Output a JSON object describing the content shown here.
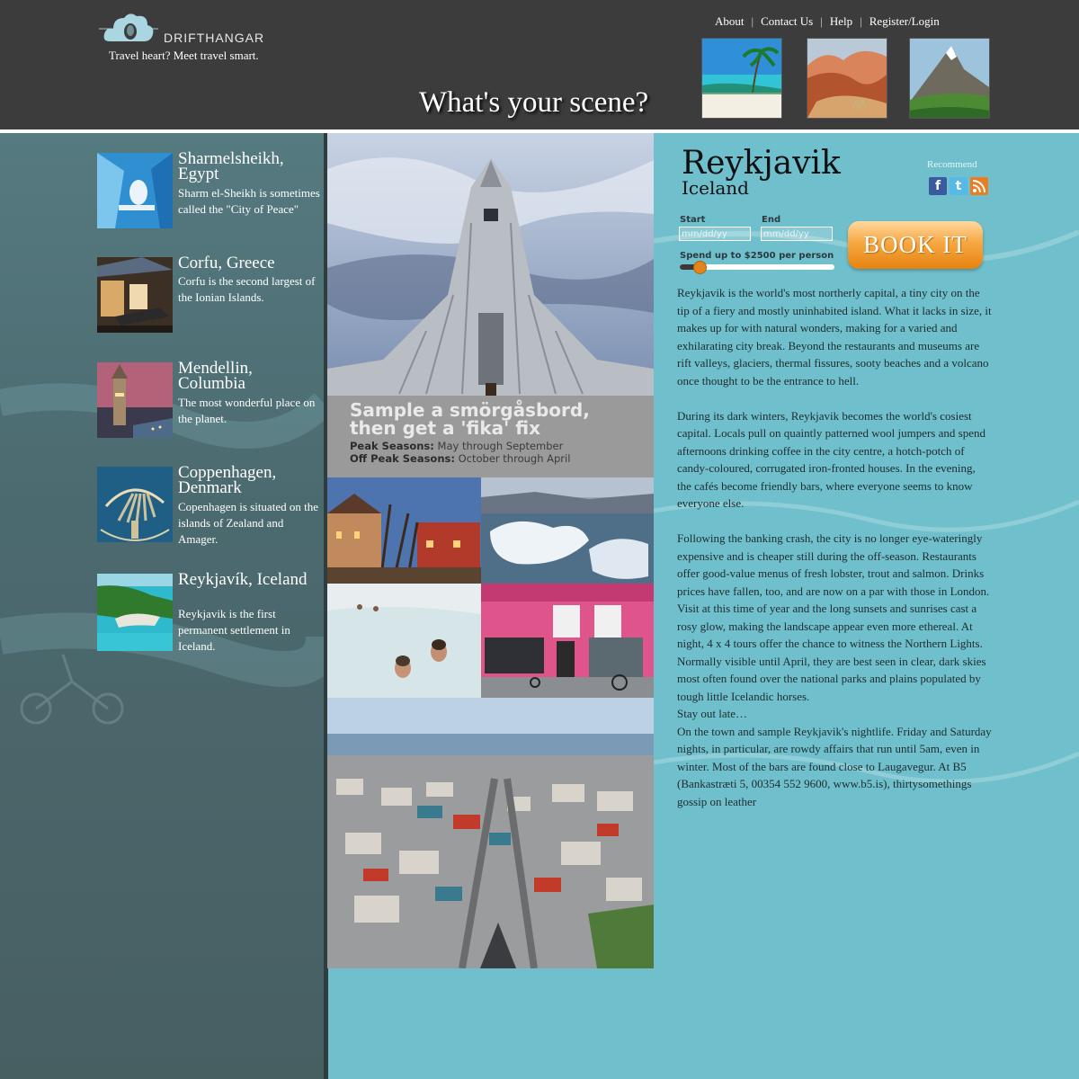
{
  "brand": {
    "name": "DRIFTHANGAR",
    "tagline": "Travel heart?  Meet travel smart."
  },
  "nav": {
    "items": [
      "About",
      "Contact Us",
      "Help",
      "Register/Login"
    ],
    "separator": "|"
  },
  "scene": {
    "title": "What's your scene?",
    "thumbnails": [
      "tropical-beach",
      "red-rock-desert",
      "green-mountain"
    ]
  },
  "sidebar": {
    "destinations": [
      {
        "title": "Sharmelsheikh, Egypt",
        "description": "Sharm el-Sheikh is sometimes called the \"City of Peace\""
      },
      {
        "title": "Corfu, Greece",
        "description": "Corfu is the second largest of the Ionian Islands."
      },
      {
        "title": "Mendellin, Columbia",
        "description": "The most wonderful place on the planet."
      },
      {
        "title": "Coppenhagen, Denmark",
        "description": "Copenhagen is situated on the islands of Zealand and Amager."
      },
      {
        "title": "Reykjavík, Iceland",
        "description": "Reykjavik is the first permanent settlement in Iceland."
      }
    ]
  },
  "collage": {
    "caption": {
      "headline": "Sample a smörgåsbord, then get a 'fika' fix",
      "peak_label": "Peak Seasons:",
      "peak_value": "May through September",
      "offpeak_label": "Off Peak Seasons:",
      "offpeak_value": "October through April"
    }
  },
  "detail": {
    "city": "Reykjavik",
    "country": "Iceland",
    "recommend_label": "Recommend",
    "share_icons": [
      "facebook-icon",
      "twitter-icon",
      "rss-icon"
    ],
    "booking": {
      "start_label": "Start",
      "end_label": "End",
      "start_placeholder": "mm/dd/yy",
      "end_placeholder": "mm/dd/yy",
      "spend_label": "Spend up to $2500 per person",
      "slider_fraction": 0.13,
      "book_label": "BOOK IT"
    },
    "paragraphs": [
      "Reykjavik is the world's most northerly capital, a tiny city on the tip of a fiery and mostly uninhabited island. What it lacks in size, it makes up for with natural wonders, making for a varied and exhilarating city break. Beyond the restaurants and museums are rift valleys, glaciers, thermal fissures, sooty beaches and a volcano once thought to be the entrance to hell.",
      "During its dark winters, Reykjavik becomes the world's cosiest capital. Locals pull on quaintly patterned wool jumpers and spend afternoons drinking coffee in the city centre, a hotch-potch of candy-coloured, corrugated iron-fronted houses. In the evening, the cafés become friendly bars, where everyone seems to know everyone else.",
      "Following the banking crash, the city is no longer eye-wateringly expensive and is cheaper still during the off-season. Restaurants offer good-value menus of fresh lobster, trout and salmon. Drinks prices have fallen, too, and are now on a par with those in London.",
      "Visit at this time of year and the long sunsets and sunrises cast a rosy glow, making the landscape appear even more ethereal. At night, 4 x 4 tours offer the chance to witness the Northern Lights. Normally visible until April, they are best seen in clear, dark skies most often found over the national parks and plains populated by tough little Icelandic horses.",
      "Stay out late…",
      "On the town and sample Reykjavik's nightlife. Friday and Saturday nights, in particular, are rowdy affairs that run until 5am, even in winter. Most of the bars are found close to Laugavegur. At B5 (Bankastræti 5, 00354 552 9600, www.b5.is), thirtysomethings gossip on leather"
    ]
  },
  "colors": {
    "header_bg": "#3c3c3c",
    "sidebar_bg": "#4b6a6f",
    "content_bg": "#6fbfcc",
    "book_button": "#f6a843",
    "caption_bg": "#9a9a9a"
  }
}
